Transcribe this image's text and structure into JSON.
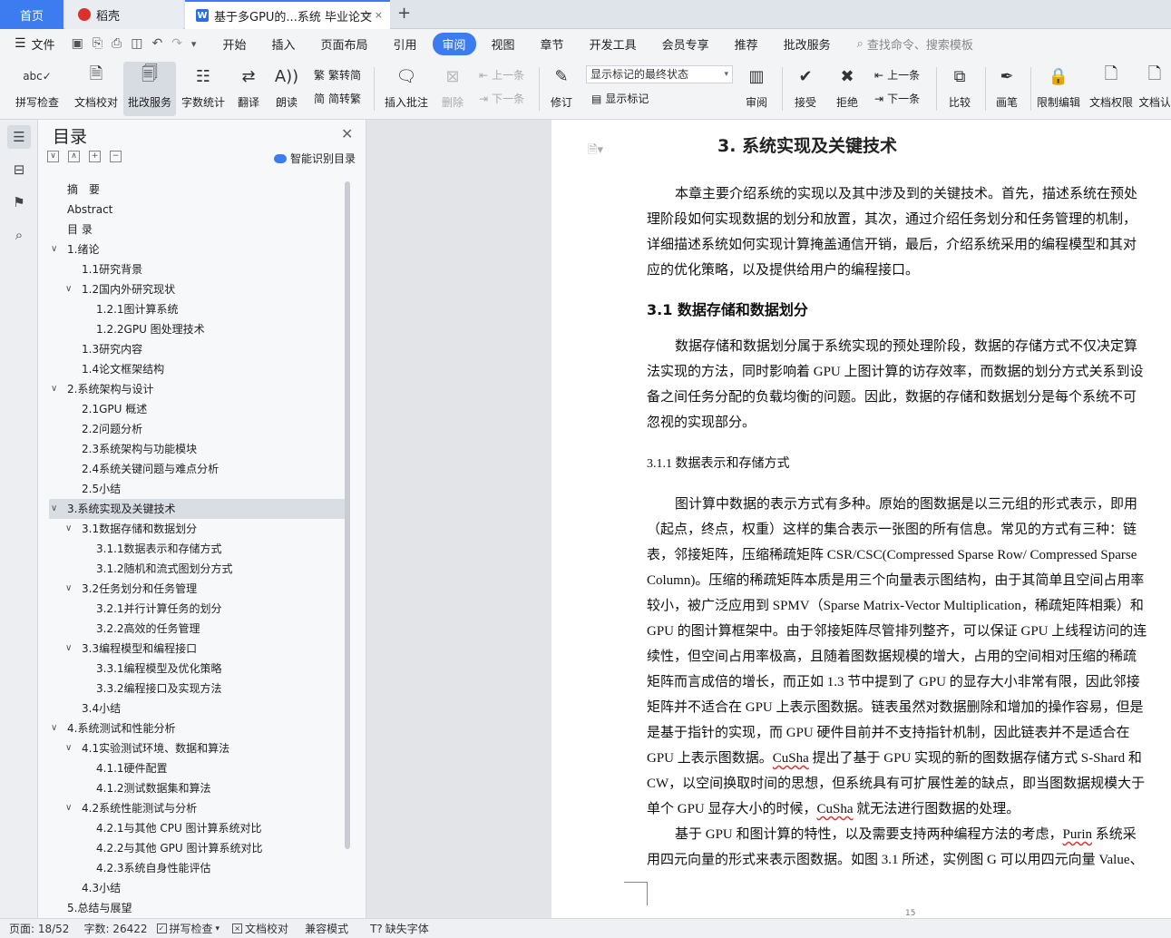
{
  "tabs": {
    "home": "首页",
    "daoke": "稻壳",
    "doc": "基于多GPU的...系统 毕业论文"
  },
  "menu": {
    "file": "文件",
    "tabs": [
      "开始",
      "插入",
      "页面布局",
      "引用",
      "审阅",
      "视图",
      "章节",
      "开发工具",
      "会员专享",
      "推荐",
      "批改服务"
    ],
    "active_index": 4,
    "search": "查找命令、搜索模板"
  },
  "ribbon": {
    "spell": "拼写检查",
    "proof": "文档校对",
    "correct": "批改服务",
    "wordcount": "字数统计",
    "translate": "翻译",
    "read": "朗读",
    "trad": "繁转简",
    "simp": "简转繁",
    "insert_comment": "插入批注",
    "delete": "删除",
    "prev": "上一条",
    "next": "下一条",
    "track": "修订",
    "markup_mode": "显示标记的最终状态",
    "show_markup": "显示标记",
    "review": "审阅",
    "accept": "接受",
    "reject": "拒绝",
    "prev2": "上一条",
    "next2": "下一条",
    "compare": "比较",
    "pen": "画笔",
    "restrict": "限制编辑",
    "perm": "文档权限",
    "doc_more": "文档认"
  },
  "toc": {
    "title": "目录",
    "smart": "智能识别目录",
    "items": [
      {
        "level": 0,
        "text": "摘　要",
        "toggle": ""
      },
      {
        "level": 0,
        "text": "Abstract",
        "toggle": ""
      },
      {
        "level": 0,
        "text": "目  录",
        "toggle": ""
      },
      {
        "level": 0,
        "text": "1.绪论",
        "toggle": "∨"
      },
      {
        "level": 1,
        "text": "1.1研究背景",
        "toggle": ""
      },
      {
        "level": 1,
        "text": "1.2国内外研究现状",
        "toggle": "∨"
      },
      {
        "level": 2,
        "text": "1.2.1图计算系统",
        "toggle": ""
      },
      {
        "level": 2,
        "text": "1.2.2GPU 图处理技术",
        "toggle": ""
      },
      {
        "level": 1,
        "text": "1.3研究内容",
        "toggle": ""
      },
      {
        "level": 1,
        "text": "1.4论文框架结构",
        "toggle": ""
      },
      {
        "level": 0,
        "text": "2.系统架构与设计",
        "toggle": "∨"
      },
      {
        "level": 1,
        "text": "2.1GPU 概述",
        "toggle": ""
      },
      {
        "level": 1,
        "text": "2.2问题分析",
        "toggle": ""
      },
      {
        "level": 1,
        "text": "2.3系统架构与功能模块",
        "toggle": ""
      },
      {
        "level": 1,
        "text": "2.4系统关键问题与难点分析",
        "toggle": ""
      },
      {
        "level": 1,
        "text": "2.5小结",
        "toggle": ""
      },
      {
        "level": 0,
        "text": "3.系统实现及关键技术",
        "toggle": "∨"
      },
      {
        "level": 1,
        "text": "3.1数据存储和数据划分",
        "toggle": "∨"
      },
      {
        "level": 2,
        "text": "3.1.1数据表示和存储方式",
        "toggle": ""
      },
      {
        "level": 2,
        "text": "3.1.2随机和流式图划分方式",
        "toggle": ""
      },
      {
        "level": 1,
        "text": "3.2任务划分和任务管理",
        "toggle": "∨"
      },
      {
        "level": 2,
        "text": "3.2.1并行计算任务的划分",
        "toggle": ""
      },
      {
        "level": 2,
        "text": "3.2.2高效的任务管理",
        "toggle": ""
      },
      {
        "level": 1,
        "text": "3.3编程模型和编程接口",
        "toggle": "∨"
      },
      {
        "level": 2,
        "text": "3.3.1编程模型及优化策略",
        "toggle": ""
      },
      {
        "level": 2,
        "text": "3.3.2编程接口及实现方法",
        "toggle": ""
      },
      {
        "level": 1,
        "text": "3.4小结",
        "toggle": ""
      },
      {
        "level": 0,
        "text": "4.系统测试和性能分析",
        "toggle": "∨"
      },
      {
        "level": 1,
        "text": "4.1实验测试环境、数据和算法",
        "toggle": "∨"
      },
      {
        "level": 2,
        "text": "4.1.1硬件配置",
        "toggle": ""
      },
      {
        "level": 2,
        "text": "4.1.2测试数据集和算法",
        "toggle": ""
      },
      {
        "level": 1,
        "text": "4.2系统性能测试与分析",
        "toggle": "∨"
      },
      {
        "level": 2,
        "text": "4.2.1与其他 CPU 图计算系统对比",
        "toggle": ""
      },
      {
        "level": 2,
        "text": "4.2.2与其他 GPU 图计算系统对比",
        "toggle": ""
      },
      {
        "level": 2,
        "text": "4.2.3系统自身性能评估",
        "toggle": ""
      },
      {
        "level": 1,
        "text": "4.3小结",
        "toggle": ""
      },
      {
        "level": 0,
        "text": "5.总结与展望",
        "toggle": ""
      }
    ],
    "selected_index": 16
  },
  "doc": {
    "h1": "3.  系统实现及关键技术",
    "p1": [
      "本章主要介绍系统的实现以及其中涉及到的关键技术。首先，描述系统在预处",
      "理阶段如何实现数据的划分和放置，其次，通过介绍任务划分和任务管理的机制，",
      "详细描述系统如何实现计算掩盖通信开销，最后，介绍系统采用的编程模型和其对",
      "应的优化策略，以及提供给用户的编程接口。"
    ],
    "h2": "3.1 数据存储和数据划分",
    "p2": [
      "数据存储和数据划分属于系统实现的预处理阶段，数据的存储方式不仅决定算",
      "法实现的方法，同时影响着 GPU 上图计算的访存效率，而数据的划分方式关系到设",
      "备之间任务分配的负载均衡的问题。因此，数据的存储和数据划分是每个系统不可",
      "忽视的实现部分。"
    ],
    "h3": "3.1.1    数据表示和存储方式",
    "p3": [
      "图计算中数据的表示方式有多种。原始的图数据是以三元组的形式表示，即用",
      "（起点，终点，权重）这样的集合表示一张图的所有信息。常见的方式有三种：链",
      "表，邻接矩阵，压缩稀疏矩阵 CSR/CSC(Compressed Sparse Row/ Compressed Sparse",
      "Column)。压缩的稀疏矩阵本质是用三个向量表示图结构，由于其简单且空间占用率",
      "较小，被广泛应用到 SPMV（Sparse Matrix-Vector Multiplication，稀疏矩阵相乘）和",
      "GPU 的图计算框架中。由于邻接矩阵尽管排列整齐，可以保证 GPU 上线程访问的连",
      "续性，但空间占用率极高，且随着图数据规模的增大，占用的空间相对压缩的稀疏",
      "矩阵而言成倍的增长，而正如 1.3 节中提到了 GPU 的显存大小非常有限，因此邻接",
      "矩阵并不适合在 GPU 上表示图数据。链表虽然对数据删除和增加的操作容易，但是",
      "是基于指针的实现，而 GPU 硬件目前并不支持指针机制，因此链表并不是适合在"
    ],
    "p3_cusha1_before": "GPU 上表示图数据。",
    "p3_cusha1": "CuSha",
    "p3_cusha1_after": " 提出了基于 GPU 实现的新的图数据存储方式 S-Shard 和",
    "p3_l2": "CW，以空间换取时间的思想，但系统具有可扩展性差的缺点，即当图数据规模大于",
    "p3_l3_before": "单个 GPU 显存大小的时候，",
    "p3_cusha2": "CuSha",
    "p3_l3_after": " 就无法进行图数据的处理。",
    "p4_before": "基于 GPU 和图计算的特性，以及需要支持两种编程方法的考虑，",
    "p4_purin": "Purin",
    "p4_after": " 系统采",
    "p4_l2": "用四元向量的形式来表示图数据。如图 3.1 所述，实例图 G 可以用四元向量 Value、",
    "page_number": "15"
  },
  "status": {
    "page": "页面: 18/52",
    "words": "字数: 26422",
    "spell": "拼写检查",
    "proof": "文档校对",
    "compat": "兼容模式",
    "missing_font": "缺失字体"
  },
  "colors": {
    "accent": "#3d7cf0"
  }
}
